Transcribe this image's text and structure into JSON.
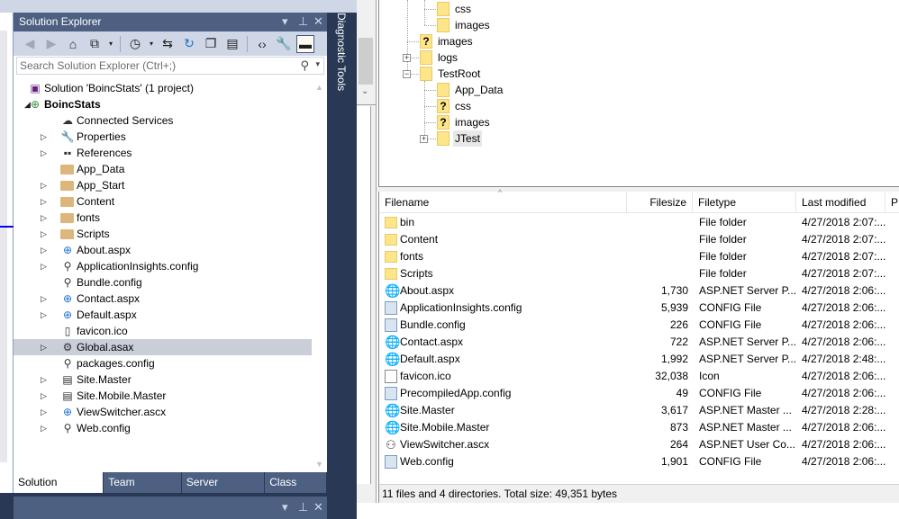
{
  "colors": {
    "vs_frame": "#293955",
    "vs_title": "#4d6082",
    "vs_toolbar": "#cfd6e5",
    "selection": "#c9ced9"
  },
  "solution_explorer": {
    "title": "Solution Explorer",
    "controls": {
      "dropdown": "▾",
      "pin": "⊥",
      "close": "✕"
    },
    "toolbar": [
      "back-icon",
      "forward-icon",
      "home-icon",
      "switch-views-icon",
      "pending-changes-filter-icon",
      "sync-icon",
      "refresh-icon",
      "collapse-all-icon",
      "show-all-files-icon",
      "view-code-icon",
      "properties-icon",
      "preview-selected-icon"
    ],
    "search_placeholder": "Search Solution Explorer (Ctrl+;)",
    "tree": [
      {
        "label": "Solution 'BoincStats' (1 project)",
        "icon": "solution-icon",
        "level": 0,
        "expander": "none"
      },
      {
        "label": "BoincStats",
        "icon": "web-project-icon",
        "level": 0,
        "expander": "expanded",
        "bold": true
      },
      {
        "label": "Connected Services",
        "icon": "connected-services-icon",
        "level": 1,
        "expander": "none"
      },
      {
        "label": "Properties",
        "icon": "wrench-icon",
        "level": 1,
        "expander": "collapsed"
      },
      {
        "label": "References",
        "icon": "references-icon",
        "level": 1,
        "expander": "collapsed"
      },
      {
        "label": "App_Data",
        "icon": "folder-icon",
        "level": 1,
        "expander": "none"
      },
      {
        "label": "App_Start",
        "icon": "folder-icon",
        "level": 1,
        "expander": "collapsed"
      },
      {
        "label": "Content",
        "icon": "folder-icon",
        "level": 1,
        "expander": "collapsed"
      },
      {
        "label": "fonts",
        "icon": "folder-icon",
        "level": 1,
        "expander": "collapsed"
      },
      {
        "label": "Scripts",
        "icon": "folder-icon",
        "level": 1,
        "expander": "collapsed"
      },
      {
        "label": "About.aspx",
        "icon": "web-form-icon",
        "level": 1,
        "expander": "collapsed"
      },
      {
        "label": "ApplicationInsights.config",
        "icon": "config-icon",
        "level": 1,
        "expander": "collapsed"
      },
      {
        "label": "Bundle.config",
        "icon": "config-icon",
        "level": 1,
        "expander": "none"
      },
      {
        "label": "Contact.aspx",
        "icon": "web-form-icon",
        "level": 1,
        "expander": "collapsed"
      },
      {
        "label": "Default.aspx",
        "icon": "web-form-icon",
        "level": 1,
        "expander": "collapsed"
      },
      {
        "label": "favicon.ico",
        "icon": "icon-file-icon",
        "level": 1,
        "expander": "none"
      },
      {
        "label": "Global.asax",
        "icon": "global-asax-icon",
        "level": 1,
        "expander": "collapsed",
        "selected": true
      },
      {
        "label": "packages.config",
        "icon": "config-icon",
        "level": 1,
        "expander": "none"
      },
      {
        "label": "Site.Master",
        "icon": "master-page-icon",
        "level": 1,
        "expander": "collapsed"
      },
      {
        "label": "Site.Mobile.Master",
        "icon": "master-page-icon",
        "level": 1,
        "expander": "collapsed"
      },
      {
        "label": "ViewSwitcher.ascx",
        "icon": "user-control-icon",
        "level": 1,
        "expander": "collapsed"
      },
      {
        "label": "Web.config",
        "icon": "config-icon",
        "level": 1,
        "expander": "collapsed"
      }
    ],
    "tabs": [
      {
        "label": "Solution Explorer",
        "active": true
      },
      {
        "label": "Team Explorer"
      },
      {
        "label": "Server Explorer"
      },
      {
        "label": "Class View"
      }
    ]
  },
  "diagnostic_tools": {
    "label": "Diagnostic Tools"
  },
  "remote_tree": [
    {
      "label": "css",
      "level": 3,
      "icon": "folder",
      "expander": "none"
    },
    {
      "label": "images",
      "level": 3,
      "icon": "folder",
      "expander": "none"
    },
    {
      "label": "images",
      "level": 2,
      "icon": "unknown-folder",
      "expander": "none"
    },
    {
      "label": "logs",
      "level": 2,
      "icon": "folder",
      "expander": "collapsed"
    },
    {
      "label": "TestRoot",
      "level": 2,
      "icon": "folder",
      "expander": "expanded"
    },
    {
      "label": "App_Data",
      "level": 3,
      "icon": "folder",
      "expander": "none"
    },
    {
      "label": "css",
      "level": 3,
      "icon": "unknown-folder",
      "expander": "none"
    },
    {
      "label": "images",
      "level": 3,
      "icon": "unknown-folder",
      "expander": "none"
    },
    {
      "label": "JTest",
      "level": 3,
      "icon": "folder",
      "expander": "collapsed",
      "highlighted": true
    }
  ],
  "file_list": {
    "columns": [
      "Filename",
      "Filesize",
      "Filetype",
      "Last modified",
      "P"
    ],
    "sort": {
      "column": "Filename",
      "direction": "ascending"
    },
    "rows": [
      {
        "name": "bin",
        "size": "",
        "type": "File folder",
        "modified": "4/27/2018 2:07:...",
        "icon": "folder"
      },
      {
        "name": "Content",
        "size": "",
        "type": "File folder",
        "modified": "4/27/2018 2:07:...",
        "icon": "folder"
      },
      {
        "name": "fonts",
        "size": "",
        "type": "File folder",
        "modified": "4/27/2018 2:07:...",
        "icon": "folder"
      },
      {
        "name": "Scripts",
        "size": "",
        "type": "File folder",
        "modified": "4/27/2018 2:07:...",
        "icon": "folder"
      },
      {
        "name": "About.aspx",
        "size": "1,730",
        "type": "ASP.NET Server P...",
        "modified": "4/27/2018 2:06:...",
        "icon": "web"
      },
      {
        "name": "ApplicationInsights.config",
        "size": "5,939",
        "type": "CONFIG File",
        "modified": "4/27/2018 2:06:...",
        "icon": "cfg"
      },
      {
        "name": "Bundle.config",
        "size": "226",
        "type": "CONFIG File",
        "modified": "4/27/2018 2:06:...",
        "icon": "cfg"
      },
      {
        "name": "Contact.aspx",
        "size": "722",
        "type": "ASP.NET Server P...",
        "modified": "4/27/2018 2:06:...",
        "icon": "web"
      },
      {
        "name": "Default.aspx",
        "size": "1,992",
        "type": "ASP.NET Server P...",
        "modified": "4/27/2018 2:48:...",
        "icon": "web"
      },
      {
        "name": "favicon.ico",
        "size": "32,038",
        "type": "Icon",
        "modified": "4/27/2018 2:06:...",
        "icon": "doc"
      },
      {
        "name": "PrecompiledApp.config",
        "size": "49",
        "type": "CONFIG File",
        "modified": "4/27/2018 2:06:...",
        "icon": "cfg"
      },
      {
        "name": "Site.Master",
        "size": "3,617",
        "type": "ASP.NET Master ...",
        "modified": "4/27/2018 2:28:...",
        "icon": "web"
      },
      {
        "name": "Site.Mobile.Master",
        "size": "873",
        "type": "ASP.NET Master ...",
        "modified": "4/27/2018 2:06:...",
        "icon": "web"
      },
      {
        "name": "ViewSwitcher.ascx",
        "size": "264",
        "type": "ASP.NET User Co...",
        "modified": "4/27/2018 2:06:...",
        "icon": "uc"
      },
      {
        "name": "Web.config",
        "size": "1,901",
        "type": "CONFIG File",
        "modified": "4/27/2018 2:06:...",
        "icon": "cfg"
      }
    ],
    "status": "11 files and 4 directories. Total size: 49,351 bytes"
  }
}
